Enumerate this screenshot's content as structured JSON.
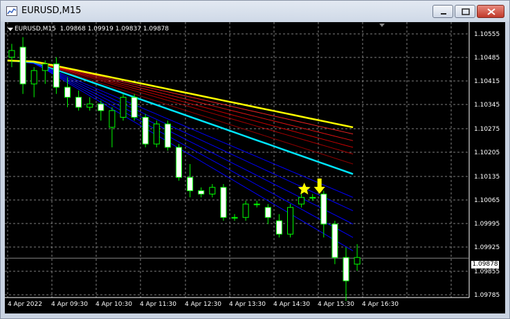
{
  "window": {
    "title": "EURUSD,M15"
  },
  "chart": {
    "header": {
      "symbol": "EURUSD,M15",
      "ohlc": "1.09868 1.09919 1.09837 1.09878"
    },
    "price_ticks": [
      "1.10555",
      "1.10485",
      "1.10415",
      "1.10345",
      "1.10275",
      "1.10205",
      "1.10135",
      "1.10065",
      "1.09995",
      "1.09925",
      "1.09855",
      "1.09785"
    ],
    "current_price": "1.09878",
    "time_labels": [
      "4 Apr 2022",
      "4 Apr 09:30",
      "4 Apr 10:30",
      "4 Apr 11:30",
      "4 Apr 12:30",
      "4 Apr 13:30",
      "4 Apr 14:30",
      "4 Apr 15:30",
      "4 Apr 16:30"
    ],
    "colors": {
      "background": "#000000",
      "grid": "#808080",
      "bull_candle": "#00ff00",
      "bear_candle_body": "#ffffff",
      "fast_ma": "#0000ff",
      "mid_ma": "#00e5ff",
      "slow_ma": "#ff0000",
      "slowest_ma": "#ffff00",
      "signal": "#ffff00"
    },
    "signal_icons": [
      "star-icon",
      "arrow-down-icon"
    ]
  },
  "chart_data": {
    "type": "candlestick",
    "symbol": "EURUSD",
    "timeframe": "M15",
    "candles": [
      {
        "o": 1.1048,
        "h": 1.1052,
        "l": 1.1045,
        "c": 1.105
      },
      {
        "o": 1.1051,
        "h": 1.1054,
        "l": 1.1037,
        "c": 1.104
      },
      {
        "o": 1.104,
        "h": 1.1045,
        "l": 1.1036,
        "c": 1.1044
      },
      {
        "o": 1.1044,
        "h": 1.1047,
        "l": 1.104,
        "c": 1.1046
      },
      {
        "o": 1.1046,
        "h": 1.1048,
        "l": 1.1037,
        "c": 1.1039
      },
      {
        "o": 1.1039,
        "h": 1.1042,
        "l": 1.1033,
        "c": 1.1036
      },
      {
        "o": 1.1036,
        "h": 1.1038,
        "l": 1.1032,
        "c": 1.1033
      },
      {
        "o": 1.1033,
        "h": 1.1036,
        "l": 1.1032,
        "c": 1.1034
      },
      {
        "o": 1.1034,
        "h": 1.1035,
        "l": 1.1029,
        "c": 1.1032
      },
      {
        "o": 1.1027,
        "h": 1.1033,
        "l": 1.1021,
        "c": 1.1032
      },
      {
        "o": 1.103,
        "h": 1.1037,
        "l": 1.1029,
        "c": 1.1036
      },
      {
        "o": 1.1036,
        "h": 1.1037,
        "l": 1.1029,
        "c": 1.103
      },
      {
        "o": 1.103,
        "h": 1.1031,
        "l": 1.1021,
        "c": 1.1022
      },
      {
        "o": 1.1022,
        "h": 1.1029,
        "l": 1.1021,
        "c": 1.1028
      },
      {
        "o": 1.1028,
        "h": 1.1029,
        "l": 1.102,
        "c": 1.1021
      },
      {
        "o": 1.1021,
        "h": 1.1022,
        "l": 1.1011,
        "c": 1.1012
      },
      {
        "o": 1.1012,
        "h": 1.1016,
        "l": 1.1006,
        "c": 1.1008
      },
      {
        "o": 1.1008,
        "h": 1.1009,
        "l": 1.1006,
        "c": 1.1007
      },
      {
        "o": 1.1007,
        "h": 1.101,
        "l": 1.1006,
        "c": 1.1009
      },
      {
        "o": 1.1009,
        "h": 1.101,
        "l": 1.0999,
        "c": 1.1
      },
      {
        "o": 1.1,
        "h": 1.1001,
        "l": 1.0999,
        "c": 1.1
      },
      {
        "o": 1.1,
        "h": 1.1005,
        "l": 1.0999,
        "c": 1.1004
      },
      {
        "o": 1.1004,
        "h": 1.1005,
        "l": 1.1003,
        "c": 1.1004
      },
      {
        "o": 1.1003,
        "h": 1.1004,
        "l": 1.0998,
        "c": 1.1
      },
      {
        "o": 1.0999,
        "h": 1.1001,
        "l": 1.0994,
        "c": 1.0995
      },
      {
        "o": 1.0995,
        "h": 1.1004,
        "l": 1.0994,
        "c": 1.1003
      },
      {
        "o": 1.1004,
        "h": 1.1007,
        "l": 1.1003,
        "c": 1.1006
      },
      {
        "o": 1.1006,
        "h": 1.1007,
        "l": 1.1005,
        "c": 1.1006
      },
      {
        "o": 1.1007,
        "h": 1.1008,
        "l": 1.0994,
        "c": 1.0998
      },
      {
        "o": 1.0998,
        "h": 1.0999,
        "l": 1.0986,
        "c": 1.0988
      },
      {
        "o": 1.0988,
        "h": 1.0991,
        "l": 1.0975,
        "c": 1.0981
      },
      {
        "o": 1.0986,
        "h": 1.0992,
        "l": 1.0984,
        "c": 1.0988
      }
    ],
    "ma_series": [
      {
        "color": "#0000ff",
        "start": 1.1047,
        "end": 1.099
      },
      {
        "color": "#0000ff",
        "start": 1.1047,
        "end": 1.0994
      },
      {
        "color": "#0000ff",
        "start": 1.1047,
        "end": 1.0998
      },
      {
        "color": "#0000ff",
        "start": 1.1047,
        "end": 1.1002
      },
      {
        "color": "#0000ff",
        "start": 1.1047,
        "end": 1.1006
      },
      {
        "color": "#00e5ff",
        "start": 1.1047,
        "end": 1.1013
      },
      {
        "color": "#8b0000",
        "start": 1.1047,
        "end": 1.1016
      },
      {
        "color": "#aa0000",
        "start": 1.1047,
        "end": 1.1019
      },
      {
        "color": "#cc0000",
        "start": 1.1047,
        "end": 1.1021
      },
      {
        "color": "#dd1111",
        "start": 1.1047,
        "end": 1.1023
      },
      {
        "color": "#ee2222",
        "start": 1.1047,
        "end": 1.1025
      },
      {
        "color": "#ffff00",
        "start": 1.1047,
        "end": 1.1027
      }
    ],
    "ylim": [
      1.0976,
      1.10585
    ]
  }
}
